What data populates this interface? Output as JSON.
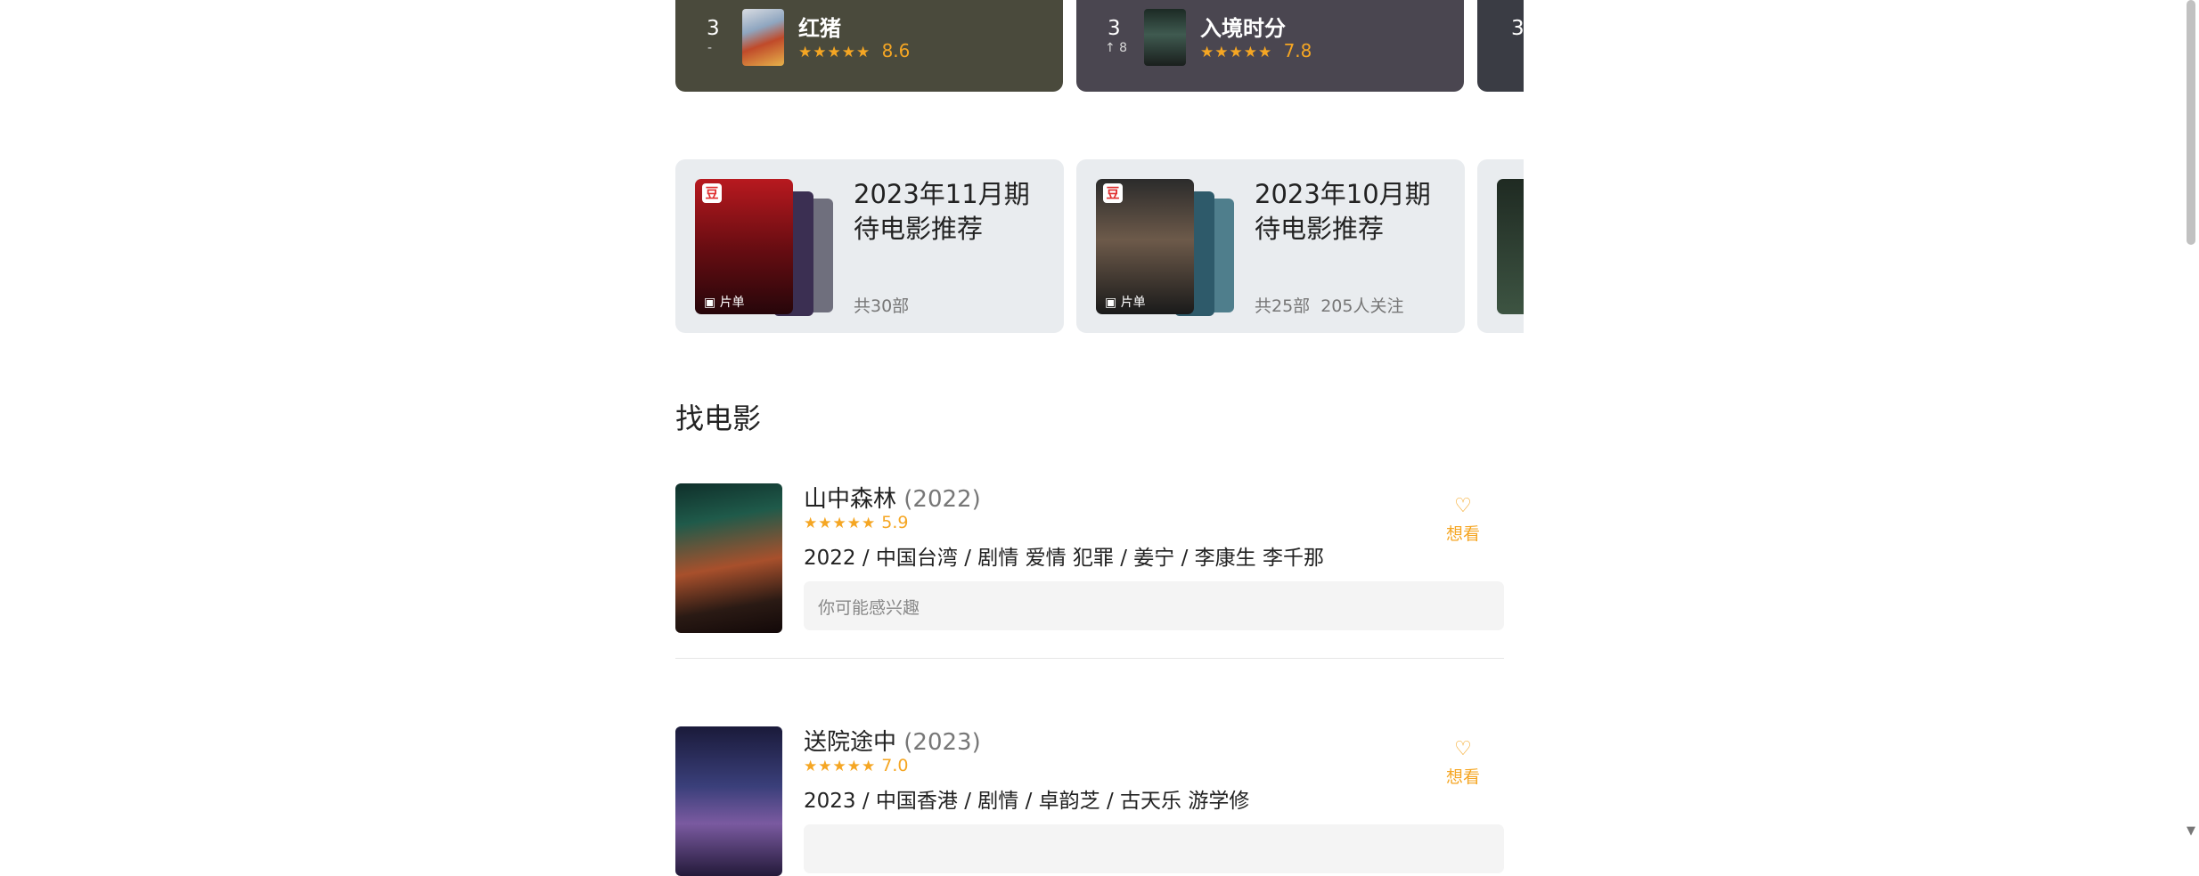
{
  "ranking": [
    {
      "rank": "3",
      "trend": "-",
      "title": "红猪",
      "stars": "★★★★★",
      "score": "8.6",
      "bg": "#4a4a3c"
    },
    {
      "rank": "3",
      "trend": "↑ 8",
      "title": "入境时分",
      "stars": "★★★★★",
      "score": "7.8",
      "bg": "#4a4650"
    },
    {
      "rank": "3",
      "bg": "#3a3c44"
    }
  ],
  "lists": [
    {
      "title": "2023年11月期待电影推荐",
      "meta": "共30部",
      "tag": "片单",
      "badge": "豆"
    },
    {
      "title": "2023年10月期待电影推荐",
      "meta": "共25部   205人关注",
      "tag": "片单",
      "badge": "豆"
    }
  ],
  "section": {
    "title": "找电影"
  },
  "movies": [
    {
      "title": "山中森林",
      "year": "(2022)",
      "stars": "★★★★★",
      "score": "5.9",
      "info": "2022 / 中国台湾 / 剧情 爱情 犯罪 / 姜宁 / 李康生 李千那",
      "suggest": "你可能感兴趣",
      "want_label": "想看"
    },
    {
      "title": "送院途中",
      "year": "(2023)",
      "stars": "★★★★★",
      "score": "7.0",
      "info": "2023 / 中国香港 / 剧情 / 卓韵芝 / 古天乐 游学修",
      "want_label": "想看"
    }
  ],
  "colors": {
    "accent": "#f5a623",
    "list_bg": "#e9ecef"
  }
}
